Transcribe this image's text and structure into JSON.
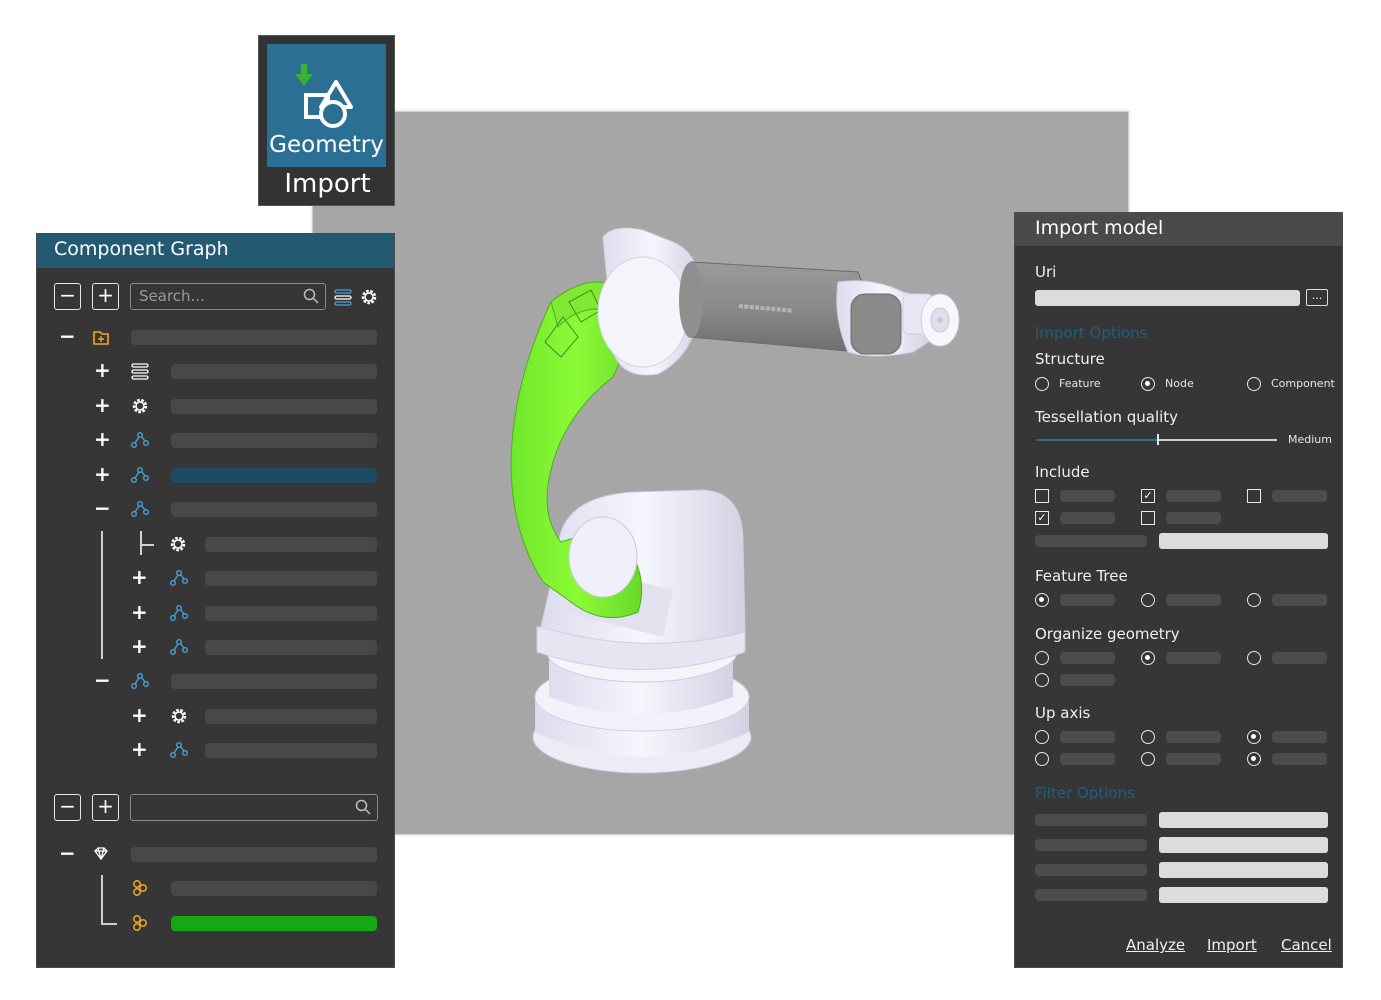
{
  "tile": {
    "title": "Geometry",
    "subtitle": "Import",
    "icon": "geometry-import-icon"
  },
  "component_graph": {
    "title": "Component Graph",
    "collapse_label": "−",
    "expand_label": "+",
    "search_placeholder": "Search...",
    "toggles": {
      "expand": "+",
      "collapse": "−"
    },
    "icons": [
      "component-folder-icon",
      "sliders-icon",
      "gear-icon",
      "node-graph-icon",
      "gem-icon",
      "cluster-icon"
    ],
    "colors": {
      "header": "#225a72",
      "selected_row": "#1f4a61",
      "highlight_row": "#16a812",
      "icon_blue": "#4aa0d8",
      "icon_orange": "#f2a922"
    }
  },
  "import_model": {
    "title": "Import model",
    "uri_label": "Uri",
    "browse_label": "...",
    "import_options_label": "Import Options",
    "structure_label": "Structure",
    "structure_options": [
      "Feature",
      "Node",
      "Component"
    ],
    "structure_selected": "Node",
    "tessellation_label": "Tessellation quality",
    "tessellation_value": "Medium",
    "tessellation_level": 0.5,
    "include_label": "Include",
    "feature_tree_label": "Feature Tree",
    "organize_label": "Organize geometry",
    "up_axis_label": "Up axis",
    "filter_options_label": "Filter Options",
    "actions": {
      "analyze": "Analyze",
      "import": "Import",
      "cancel": "Cancel"
    },
    "colors": {
      "section": "#1f5f7f"
    }
  }
}
